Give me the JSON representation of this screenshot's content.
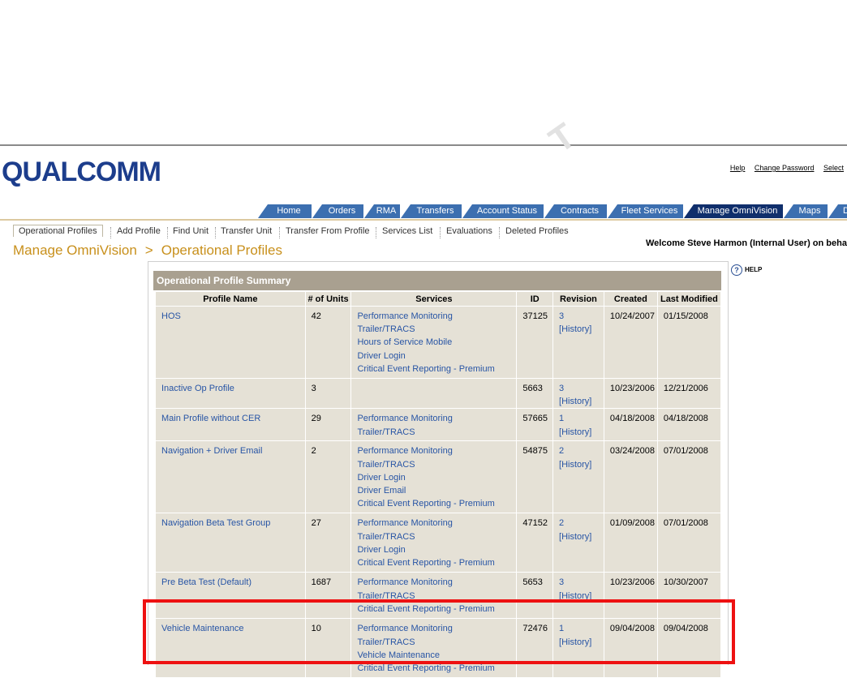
{
  "watermark": "T",
  "header": {
    "logo": "QUALCOMM",
    "links": [
      "Help",
      "Change Password",
      "Select"
    ]
  },
  "tabs": [
    {
      "label": "Home",
      "active": false
    },
    {
      "label": "Orders",
      "active": false
    },
    {
      "label": "RMA",
      "active": false
    },
    {
      "label": "Transfers",
      "active": false
    },
    {
      "label": "Account Status",
      "active": false
    },
    {
      "label": "Contracts",
      "active": false
    },
    {
      "label": "Fleet Services",
      "active": false
    },
    {
      "label": "Manage OmniVision",
      "active": true
    },
    {
      "label": "Maps",
      "active": false
    },
    {
      "label": "Do",
      "active": false
    }
  ],
  "subnav": [
    "Operational Profiles",
    "Add Profile",
    "Find Unit",
    "Transfer Unit",
    "Transfer From Profile",
    "Services List",
    "Evaluations",
    "Deleted Profiles"
  ],
  "breadcrumb": {
    "section": "Manage OmniVision",
    "separator": ">",
    "page": "Operational Profiles"
  },
  "welcome": "Welcome Steve Harmon (Internal User) on behalf",
  "help": {
    "icon": "?",
    "label": "HELP"
  },
  "summary_title": "Operational Profile Summary",
  "columns": [
    "Profile Name",
    "# of Units",
    "Services",
    "ID",
    "Revision",
    "Created",
    "Last Modified"
  ],
  "rows": [
    {
      "name": "HOS",
      "units": "42",
      "services": [
        "Performance Monitoring",
        "Trailer/TRACS",
        "Hours of Service Mobile",
        "Driver Login",
        "Critical Event Reporting - Premium"
      ],
      "id": "37125",
      "revision": "3 [History]",
      "created": "10/24/2007",
      "modified": "01/15/2008",
      "highlighted": false
    },
    {
      "name": "Inactive Op Profile",
      "units": "3",
      "services": [],
      "id": "5663",
      "revision": "3 [History]",
      "created": "10/23/2006",
      "modified": "12/21/2006",
      "highlighted": false
    },
    {
      "name": "Main Profile without CER",
      "units": "29",
      "services": [
        "Performance Monitoring",
        "Trailer/TRACS"
      ],
      "id": "57665",
      "revision": "1 [History]",
      "created": "04/18/2008",
      "modified": "04/18/2008",
      "highlighted": false
    },
    {
      "name": "Navigation + Driver Email",
      "units": "2",
      "services": [
        "Performance Monitoring",
        "Trailer/TRACS",
        "Driver Login",
        "Driver Email",
        "Critical Event Reporting - Premium"
      ],
      "id": "54875",
      "revision": "2 [History]",
      "created": "03/24/2008",
      "modified": "07/01/2008",
      "highlighted": false
    },
    {
      "name": "Navigation Beta Test Group",
      "units": "27",
      "services": [
        "Performance Monitoring",
        "Trailer/TRACS",
        "Driver Login",
        "Critical Event Reporting - Premium"
      ],
      "id": "47152",
      "revision": "2 [History]",
      "created": "01/09/2008",
      "modified": "07/01/2008",
      "highlighted": false
    },
    {
      "name": "Pre Beta Test (Default)",
      "units": "1687",
      "services": [
        "Performance Monitoring",
        "Trailer/TRACS",
        "Critical Event Reporting - Premium"
      ],
      "id": "5653",
      "revision": "3 [History]",
      "created": "10/23/2006",
      "modified": "10/30/2007",
      "highlighted": false
    },
    {
      "name": "Vehicle Maintenance",
      "units": "10",
      "services": [
        "Performance Monitoring",
        "Trailer/TRACS",
        "Vehicle Maintenance",
        "Critical Event Reporting - Premium"
      ],
      "id": "72476",
      "revision": "1 [History]",
      "created": "09/04/2008",
      "modified": "09/04/2008",
      "highlighted": true
    }
  ],
  "colors": {
    "tab": "#3c6fb0",
    "tab_active": "#102f6c",
    "header_bar": "#a9a090",
    "cell": "#e5e1d6",
    "link": "#2855a5",
    "breadcrumb": "#c8901c",
    "highlight": "#ee1111"
  }
}
